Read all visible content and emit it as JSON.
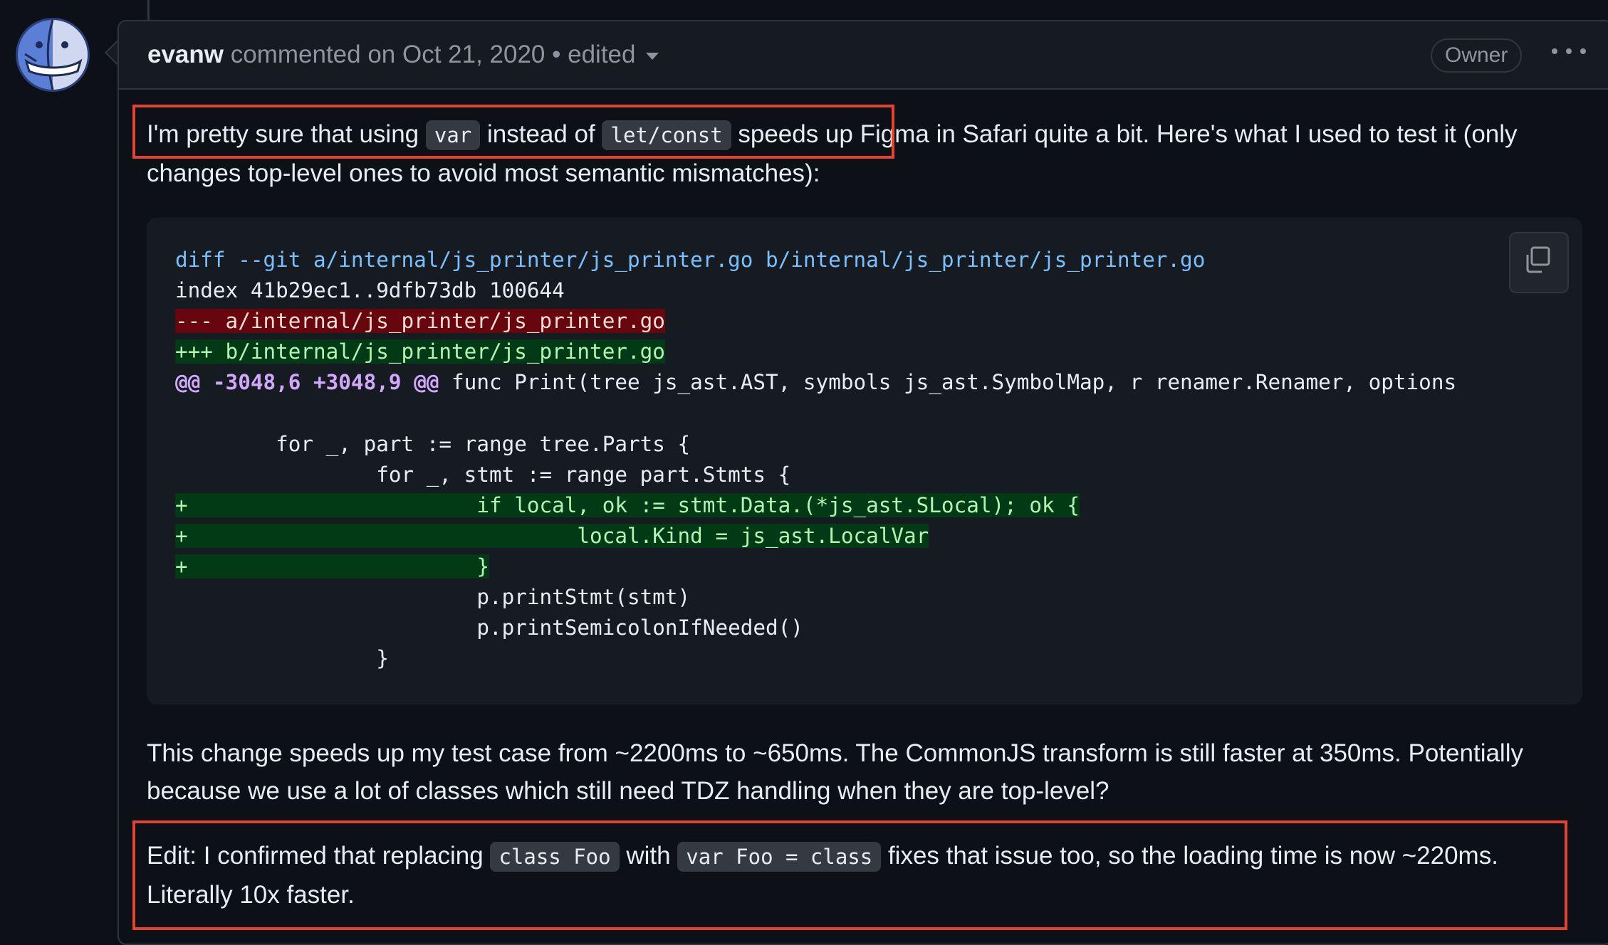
{
  "comment": {
    "author": "evanw",
    "meta": "commented on Oct 21, 2020",
    "separator": "•",
    "edited": "edited",
    "role_badge": "Owner",
    "more_icon": "kebab-horizontal-icon",
    "avatar_icon": "finder-face-icon"
  },
  "body": {
    "p1": {
      "t1": "I'm pretty sure that using ",
      "c1": "var",
      "t2": " instead of ",
      "c2": "let/const",
      "t3": " speeds up",
      "t4": " Figma in Safari quite a bit. Here's what I used to test it (only changes top-level ones to avoid most semantic mismatches):"
    },
    "code": {
      "copy_icon": "copy-icon",
      "lines": {
        "l1": "diff --git a/internal/js_printer/js_printer.go b/internal/js_printer/js_printer.go",
        "l2": "index 41b29ec1..9dfb73db 100644",
        "l3": "--- a/internal/js_printer/js_printer.go",
        "l4": "+++ b/internal/js_printer/js_printer.go",
        "l5a": "@@ -3048,6 +3048,9 @@",
        "l5b": " func Print(tree js_ast.AST, symbols js_ast.SymbolMap, r renamer.Renamer, options",
        "l6": " ",
        "l7": "        for _, part := range tree.Parts {",
        "l8": "                for _, stmt := range part.Stmts {",
        "l9": "+                       if local, ok := stmt.Data.(*js_ast.SLocal); ok {",
        "l10": "+                               local.Kind = js_ast.LocalVar",
        "l11": "+                       }",
        "l12": "                        p.printStmt(stmt)",
        "l13": "                        p.printSemicolonIfNeeded()",
        "l14": "                }"
      }
    },
    "p2": "This change speeds up my test case from ~2200ms to ~650ms. The CommonJS transform is still faster at 350ms. Potentially because we use a lot of classes which still need TDZ handling when they are top-level?",
    "p3": {
      "t1": "Edit: I confirmed that replacing ",
      "c1": "class Foo",
      "t2": " with ",
      "c2": "var Foo = class",
      "t3": " fixes that issue too, so the loading time is now ~220ms. Literally 10x faster."
    }
  },
  "colors": {
    "highlight_border": "#e5422f",
    "background": "#0d1117",
    "diff_deleted_bg": "#67060c",
    "diff_inserted_bg": "#033a16"
  }
}
